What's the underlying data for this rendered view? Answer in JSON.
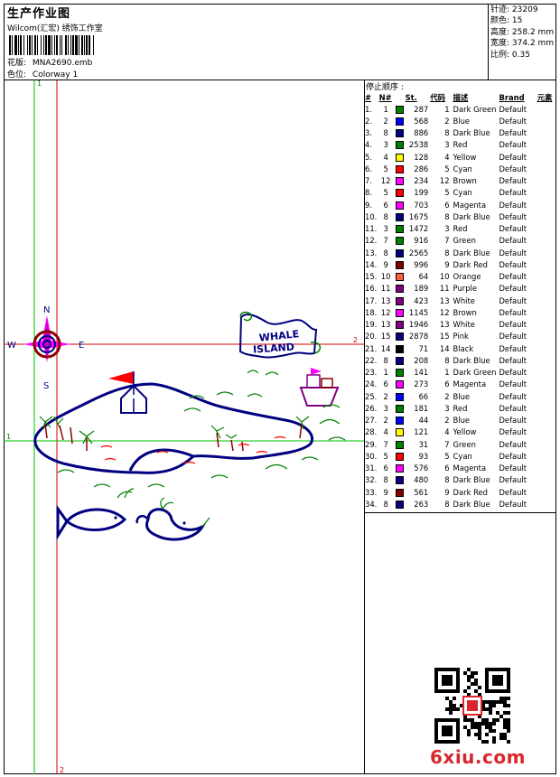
{
  "header": {
    "title": "生产作业图",
    "company": "Wilcom(汇宏) 绣饰工作室",
    "design_label": "花版:",
    "design_name": "MNA2690.emb",
    "colorway_label": "色位:",
    "colorway_name": "Colorway 1"
  },
  "stats": [
    {
      "label": "针迹",
      "value": "23209"
    },
    {
      "label": "颜色",
      "value": "15"
    },
    {
      "label": "高度",
      "value": "258.2 mm"
    },
    {
      "label": "宽度",
      "value": "374.2 mm"
    },
    {
      "label": "比例",
      "value": "0.35"
    }
  ],
  "sequence": {
    "title": "停止顺序 :",
    "headers": [
      "#",
      "N#",
      "St.",
      "代码",
      "描述",
      "Brand",
      "元素"
    ],
    "rows": [
      {
        "idx": "1.",
        "n": "1",
        "color": "#008000",
        "st": "287",
        "code": "1",
        "desc": "Dark Green",
        "brand": "Default"
      },
      {
        "idx": "2.",
        "n": "2",
        "color": "#0000ff",
        "st": "568",
        "code": "2",
        "desc": "Blue",
        "brand": "Default"
      },
      {
        "idx": "3.",
        "n": "8",
        "color": "#000080",
        "st": "886",
        "code": "8",
        "desc": "Dark Blue",
        "brand": "Default"
      },
      {
        "idx": "4.",
        "n": "3",
        "color": "#008000",
        "st": "2538",
        "code": "3",
        "desc": "Red",
        "brand": "Default"
      },
      {
        "idx": "5.",
        "n": "4",
        "color": "#ffff00",
        "st": "128",
        "code": "4",
        "desc": "Yellow",
        "brand": "Default"
      },
      {
        "idx": "6.",
        "n": "5",
        "color": "#ff0000",
        "st": "286",
        "code": "5",
        "desc": "Cyan",
        "brand": "Default"
      },
      {
        "idx": "7.",
        "n": "12",
        "color": "#ff00ff",
        "st": "234",
        "code": "12",
        "desc": "Brown",
        "brand": "Default"
      },
      {
        "idx": "8.",
        "n": "5",
        "color": "#ff0000",
        "st": "199",
        "code": "5",
        "desc": "Cyan",
        "brand": "Default"
      },
      {
        "idx": "9.",
        "n": "6",
        "color": "#ff00ff",
        "st": "703",
        "code": "6",
        "desc": "Magenta",
        "brand": "Default"
      },
      {
        "idx": "10.",
        "n": "8",
        "color": "#000080",
        "st": "1675",
        "code": "8",
        "desc": "Dark Blue",
        "brand": "Default"
      },
      {
        "idx": "11.",
        "n": "3",
        "color": "#008000",
        "st": "1472",
        "code": "3",
        "desc": "Red",
        "brand": "Default"
      },
      {
        "idx": "12.",
        "n": "7",
        "color": "#008000",
        "st": "916",
        "code": "7",
        "desc": "Green",
        "brand": "Default"
      },
      {
        "idx": "13.",
        "n": "8",
        "color": "#000080",
        "st": "2565",
        "code": "8",
        "desc": "Dark Blue",
        "brand": "Default"
      },
      {
        "idx": "14.",
        "n": "9",
        "color": "#800000",
        "st": "996",
        "code": "9",
        "desc": "Dark Red",
        "brand": "Default"
      },
      {
        "idx": "15.",
        "n": "10",
        "color": "#ff6040",
        "st": "64",
        "code": "10",
        "desc": "Orange",
        "brand": "Default"
      },
      {
        "idx": "16.",
        "n": "11",
        "color": "#800080",
        "st": "189",
        "code": "11",
        "desc": "Purple",
        "brand": "Default"
      },
      {
        "idx": "17.",
        "n": "13",
        "color": "#800080",
        "st": "423",
        "code": "13",
        "desc": "White",
        "brand": "Default"
      },
      {
        "idx": "18.",
        "n": "12",
        "color": "#ff00ff",
        "st": "1145",
        "code": "12",
        "desc": "Brown",
        "brand": "Default"
      },
      {
        "idx": "19.",
        "n": "13",
        "color": "#800080",
        "st": "1946",
        "code": "13",
        "desc": "White",
        "brand": "Default"
      },
      {
        "idx": "20.",
        "n": "15",
        "color": "#000080",
        "st": "2878",
        "code": "15",
        "desc": "Pink",
        "brand": "Default"
      },
      {
        "idx": "21.",
        "n": "14",
        "color": "#000000",
        "st": "71",
        "code": "14",
        "desc": "Black",
        "brand": "Default"
      },
      {
        "idx": "22.",
        "n": "8",
        "color": "#000080",
        "st": "208",
        "code": "8",
        "desc": "Dark Blue",
        "brand": "Default"
      },
      {
        "idx": "23.",
        "n": "1",
        "color": "#008000",
        "st": "141",
        "code": "1",
        "desc": "Dark Green",
        "brand": "Default"
      },
      {
        "idx": "24.",
        "n": "6",
        "color": "#ff00ff",
        "st": "273",
        "code": "6",
        "desc": "Magenta",
        "brand": "Default"
      },
      {
        "idx": "25.",
        "n": "2",
        "color": "#0000ff",
        "st": "66",
        "code": "2",
        "desc": "Blue",
        "brand": "Default"
      },
      {
        "idx": "26.",
        "n": "3",
        "color": "#008000",
        "st": "181",
        "code": "3",
        "desc": "Red",
        "brand": "Default"
      },
      {
        "idx": "27.",
        "n": "2",
        "color": "#0000ff",
        "st": "44",
        "code": "2",
        "desc": "Blue",
        "brand": "Default"
      },
      {
        "idx": "28.",
        "n": "4",
        "color": "#ffff00",
        "st": "121",
        "code": "4",
        "desc": "Yellow",
        "brand": "Default"
      },
      {
        "idx": "29.",
        "n": "7",
        "color": "#008000",
        "st": "31",
        "code": "7",
        "desc": "Green",
        "brand": "Default"
      },
      {
        "idx": "30.",
        "n": "5",
        "color": "#ff0000",
        "st": "93",
        "code": "5",
        "desc": "Cyan",
        "brand": "Default"
      },
      {
        "idx": "31.",
        "n": "6",
        "color": "#ff00ff",
        "st": "576",
        "code": "6",
        "desc": "Magenta",
        "brand": "Default"
      },
      {
        "idx": "32.",
        "n": "8",
        "color": "#000080",
        "st": "480",
        "code": "8",
        "desc": "Dark Blue",
        "brand": "Default"
      },
      {
        "idx": "33.",
        "n": "9",
        "color": "#800000",
        "st": "561",
        "code": "9",
        "desc": "Dark Red",
        "brand": "Default"
      },
      {
        "idx": "34.",
        "n": "8",
        "color": "#000080",
        "st": "263",
        "code": "8",
        "desc": "Dark Blue",
        "brand": "Default"
      }
    ]
  },
  "design": {
    "compass": {
      "n": "N",
      "s": "S",
      "e": "E",
      "w": "W"
    },
    "banner_line1": "WHALE",
    "banner_line2": "ISLAND",
    "guides": {
      "h1_start": "1",
      "h1_end": "1",
      "h2_end": "2",
      "v1_top": "1",
      "v2_bottom": "2"
    }
  },
  "watermark": "6xiu.com"
}
